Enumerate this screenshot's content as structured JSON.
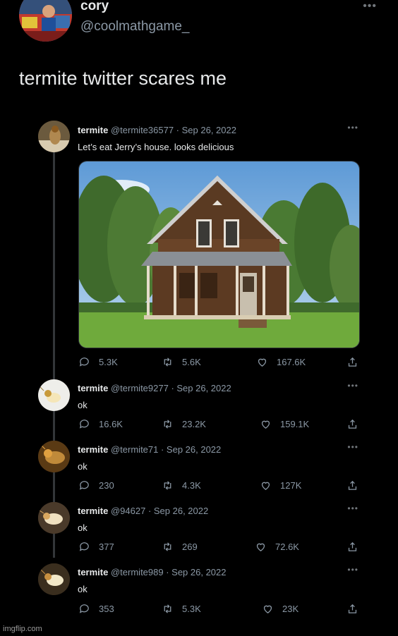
{
  "author": {
    "name": "cory",
    "handle": "@coolmathgame_",
    "more": "•••"
  },
  "main_text": "termite twitter scares me",
  "tweets": [
    {
      "name": "termite",
      "meta": "@termite36577 · Sep 26, 2022",
      "text": "Let’s eat Jerry’s house. looks delicious",
      "replies": "5.3K",
      "retweets": "5.6K",
      "likes": "167.6K"
    },
    {
      "name": "termite",
      "meta": "@termite9277 · Sep 26, 2022",
      "text": "ok",
      "replies": "16.6K",
      "retweets": "23.2K",
      "likes": "159.1K"
    },
    {
      "name": "termite",
      "meta": "@termite71 · Sep 26, 2022",
      "text": "ok",
      "replies": "230",
      "retweets": "4.3K",
      "likes": "127K"
    },
    {
      "name": "termite",
      "meta": "@94627 · Sep 26, 2022",
      "text": "ok",
      "replies": "377",
      "retweets": "269",
      "likes": "72.6K"
    },
    {
      "name": "termite",
      "meta": "@termite989 · Sep 26, 2022",
      "text": "ok",
      "replies": "353",
      "retweets": "5.3K",
      "likes": "23K"
    }
  ],
  "more_label": "•••",
  "watermark": "imgflip.com",
  "colors": {
    "background": "#000000",
    "text": "#e7e9ea",
    "muted": "#8b98a5",
    "thread": "#333639"
  }
}
